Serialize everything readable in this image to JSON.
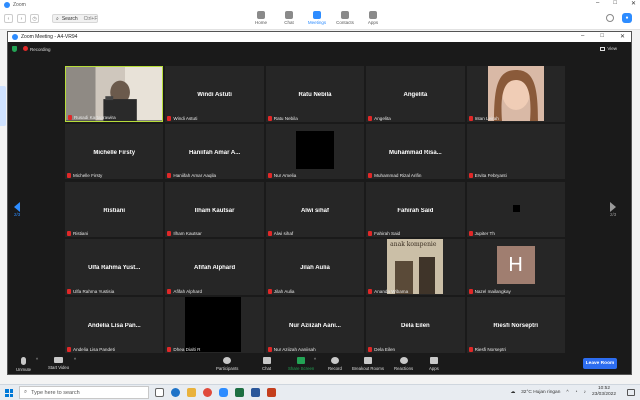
{
  "client": {
    "app_title": "Zoom",
    "search_label": "Search",
    "search_shortcut": "Ctrl+F",
    "nav": [
      {
        "label": "Home",
        "icon": "home-icon"
      },
      {
        "label": "Chat",
        "icon": "chat-icon"
      },
      {
        "label": "Meetings",
        "icon": "meetings-icon",
        "active": true
      },
      {
        "label": "Contacts",
        "icon": "contacts-icon"
      },
      {
        "label": "Apps",
        "icon": "apps-icon"
      }
    ],
    "accent_color": "#2d8cff"
  },
  "meeting": {
    "title": "Zoom Meeting - A4-VR94",
    "recording_label": "Recording",
    "view_label": "View",
    "page_left": "2/3",
    "page_right": "2/3",
    "participants": [
      {
        "name": "Rusadi Kartaprawira",
        "display": "",
        "media": "video",
        "active": true
      },
      {
        "name": "Windi Astuti",
        "display": "Windi Astuti",
        "media": "name"
      },
      {
        "name": "Ratu Nebila",
        "display": "Ratu Nebila",
        "media": "name"
      },
      {
        "name": "Angelita",
        "display": "Angelita",
        "media": "name"
      },
      {
        "name": "Intan Leirah",
        "display": "",
        "media": "photo"
      },
      {
        "name": "Michelle Firsty",
        "display": "Michelle Firsty",
        "media": "name"
      },
      {
        "name": "Haniifah Amar Aaqila",
        "display": "Haniifah Amar A...",
        "media": "name"
      },
      {
        "name": "Nur Amelia",
        "display": "",
        "media": "black-square"
      },
      {
        "name": "Muhammad Rizal Arifin",
        "display": "Muhammad Risa...",
        "media": "name"
      },
      {
        "name": "Ervita Febryanti",
        "display": "",
        "media": "empty"
      },
      {
        "name": "Ristiani",
        "display": "Ristiani",
        "media": "name"
      },
      {
        "name": "Ilham Kautsar",
        "display": "Ilham Kautsar",
        "media": "name"
      },
      {
        "name": "Alwi sihaf",
        "display": "Alwi sihaf",
        "media": "name"
      },
      {
        "name": "Fahirah Said",
        "display": "Fahirah Said",
        "media": "name"
      },
      {
        "name": "Jupiter Th",
        "display": "",
        "media": "small-square"
      },
      {
        "name": "Ulfa Rahma Yustisia",
        "display": "Ulfa Rahma Yust...",
        "media": "name"
      },
      {
        "name": "Afifah Alphard",
        "display": "Afifah Alphard",
        "media": "name"
      },
      {
        "name": "Jilah Aulia",
        "display": "Jilah Aulia",
        "media": "name"
      },
      {
        "name": "Ananda Wibama",
        "display": "",
        "media": "poster",
        "poster_text": "anak kompenie"
      },
      {
        "name": "Nazel mailangkay",
        "display": "",
        "media": "avatar",
        "avatar_letter": "H"
      },
      {
        "name": "Andelia Lisa Pandeti",
        "display": "Andelia Lisa Pan...",
        "media": "name"
      },
      {
        "name": "Dhea Dialti R",
        "display": "",
        "media": "black-large"
      },
      {
        "name": "Nur Aziizah Aaniisah",
        "display": "Nur Aziizah Aani...",
        "media": "name"
      },
      {
        "name": "Dela Eilen",
        "display": "Dela Eilen",
        "media": "name"
      },
      {
        "name": "Riesfi Norseptri",
        "display": "Riesfi Norseptri",
        "media": "name"
      }
    ],
    "controls": {
      "unmute": "Unmute",
      "start_video": "Start Video",
      "participants": "Participants",
      "participants_count": "29",
      "chat": "Chat",
      "share_screen": "Share Screen",
      "record": "Record",
      "breakout_rooms": "Breakout Rooms",
      "reactions": "Reactions",
      "apps": "Apps",
      "leave": "Leave Room"
    },
    "active_speaker_color": "#b7dd3a",
    "mute_color": "#e02828"
  },
  "taskbar": {
    "search_placeholder": "Type here to search",
    "weather": "32°C  Hujan ringan",
    "time": "10:52",
    "date": "23/03/2022"
  }
}
